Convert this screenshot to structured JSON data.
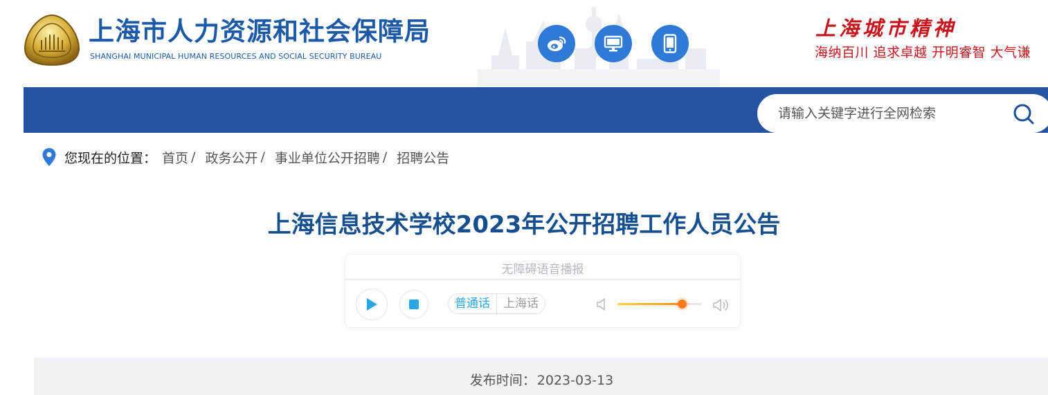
{
  "header": {
    "org_name_cn": "上海市人力资源和社会保障局",
    "org_name_en": "SHANGHAI MUNICIPAL HUMAN RESOURCES AND SOCIAL SECURITY BUREAU",
    "social_icons": [
      "weibo-icon",
      "desktop-icon",
      "mobile-icon"
    ],
    "spirit_title": "上海城市精神",
    "spirit_slogan": "海纳百川  追求卓越  开明睿智  大气谦"
  },
  "search": {
    "placeholder": "请输入关键字进行全网检索"
  },
  "breadcrumb": {
    "label": "您现在的位置：",
    "items": [
      "首页",
      "政务公开",
      "事业单位公开招聘",
      "招聘公告"
    ],
    "separator": "/"
  },
  "article": {
    "title": "上海信息技术学校2023年公开招聘工作人员公告"
  },
  "player": {
    "title": "无障碍语音播报",
    "languages": [
      "普通话",
      "上海话"
    ],
    "active_language": "普通话",
    "volume": 0.76
  },
  "publish": {
    "label": "发布时间：",
    "date": "2023-03-13"
  },
  "colors": {
    "brand_blue": "#2552a1",
    "title_blue": "#164f8f",
    "icon_blue": "#2f7ad6",
    "spirit_red": "#c8151d",
    "accent_cyan": "#2aa7e3",
    "volume_orange": "#ff7a1a"
  }
}
